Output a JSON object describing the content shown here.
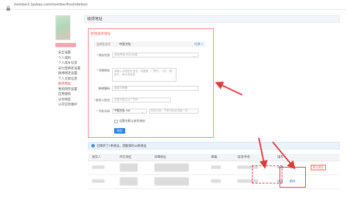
{
  "browser": {
    "url": "member1.taobao.com/member/fresh/deliver"
  },
  "sidebar": {
    "items": [
      {
        "label": "安全设置",
        "active": false
      },
      {
        "label": "个人资料",
        "active": false
      },
      {
        "label": "个人成长信息",
        "active": false
      },
      {
        "label": "支付宝绑定设置",
        "active": false
      },
      {
        "label": "微博绑定设置",
        "active": false
      },
      {
        "label": "个人交易信息",
        "active": false
      },
      {
        "label": "收货地址",
        "active": true
      },
      {
        "label": "我的网页设置",
        "active": false
      },
      {
        "label": "应用授权",
        "active": false
      },
      {
        "label": "分享绑定",
        "active": false
      },
      {
        "label": "公司信息维护",
        "active": false
      }
    ]
  },
  "main": {
    "section_title": "收货地址",
    "form": {
      "panel_title": "新增收货地址",
      "region_label": "当前配送至",
      "region_value": "中国大陆",
      "region_change": "切换 >",
      "address_info_label": "地址信息",
      "address_info_placeholder": "请选择省/市/区/街道",
      "detail_label": "详细地址",
      "detail_placeholder": "请输入详细地址信息，如道路、门牌号、小区、楼栋号、单元等信息",
      "postcode_label": "邮政编码",
      "postcode_placeholder": "请填写邮编",
      "name_label": "收货人姓名",
      "name_placeholder": "长度不超过25个字符",
      "phone_label": "手机号码",
      "phone_country": "中国大陆 +86",
      "phone_placeholder": "电话号码、手机号码必须填一项",
      "default_checkbox_label": "设置为默认收货地址",
      "save_button": "保存"
    },
    "info_text": "已保存了7条地址，还能保存13条地址",
    "table": {
      "headers": [
        "收货人",
        "所在地区",
        "详细地址",
        "邮编",
        "电话/手机",
        "操作",
        ""
      ],
      "rows": [
        {
          "op_edit": "修改",
          "op_delete": "删除",
          "default_tag": "默认地址"
        },
        {
          "op_edit": "修改",
          "op_delete": "删除",
          "default_tag": ""
        }
      ]
    }
  },
  "colors": {
    "accent_red": "#e4393c",
    "link_blue": "#2b83e3"
  }
}
